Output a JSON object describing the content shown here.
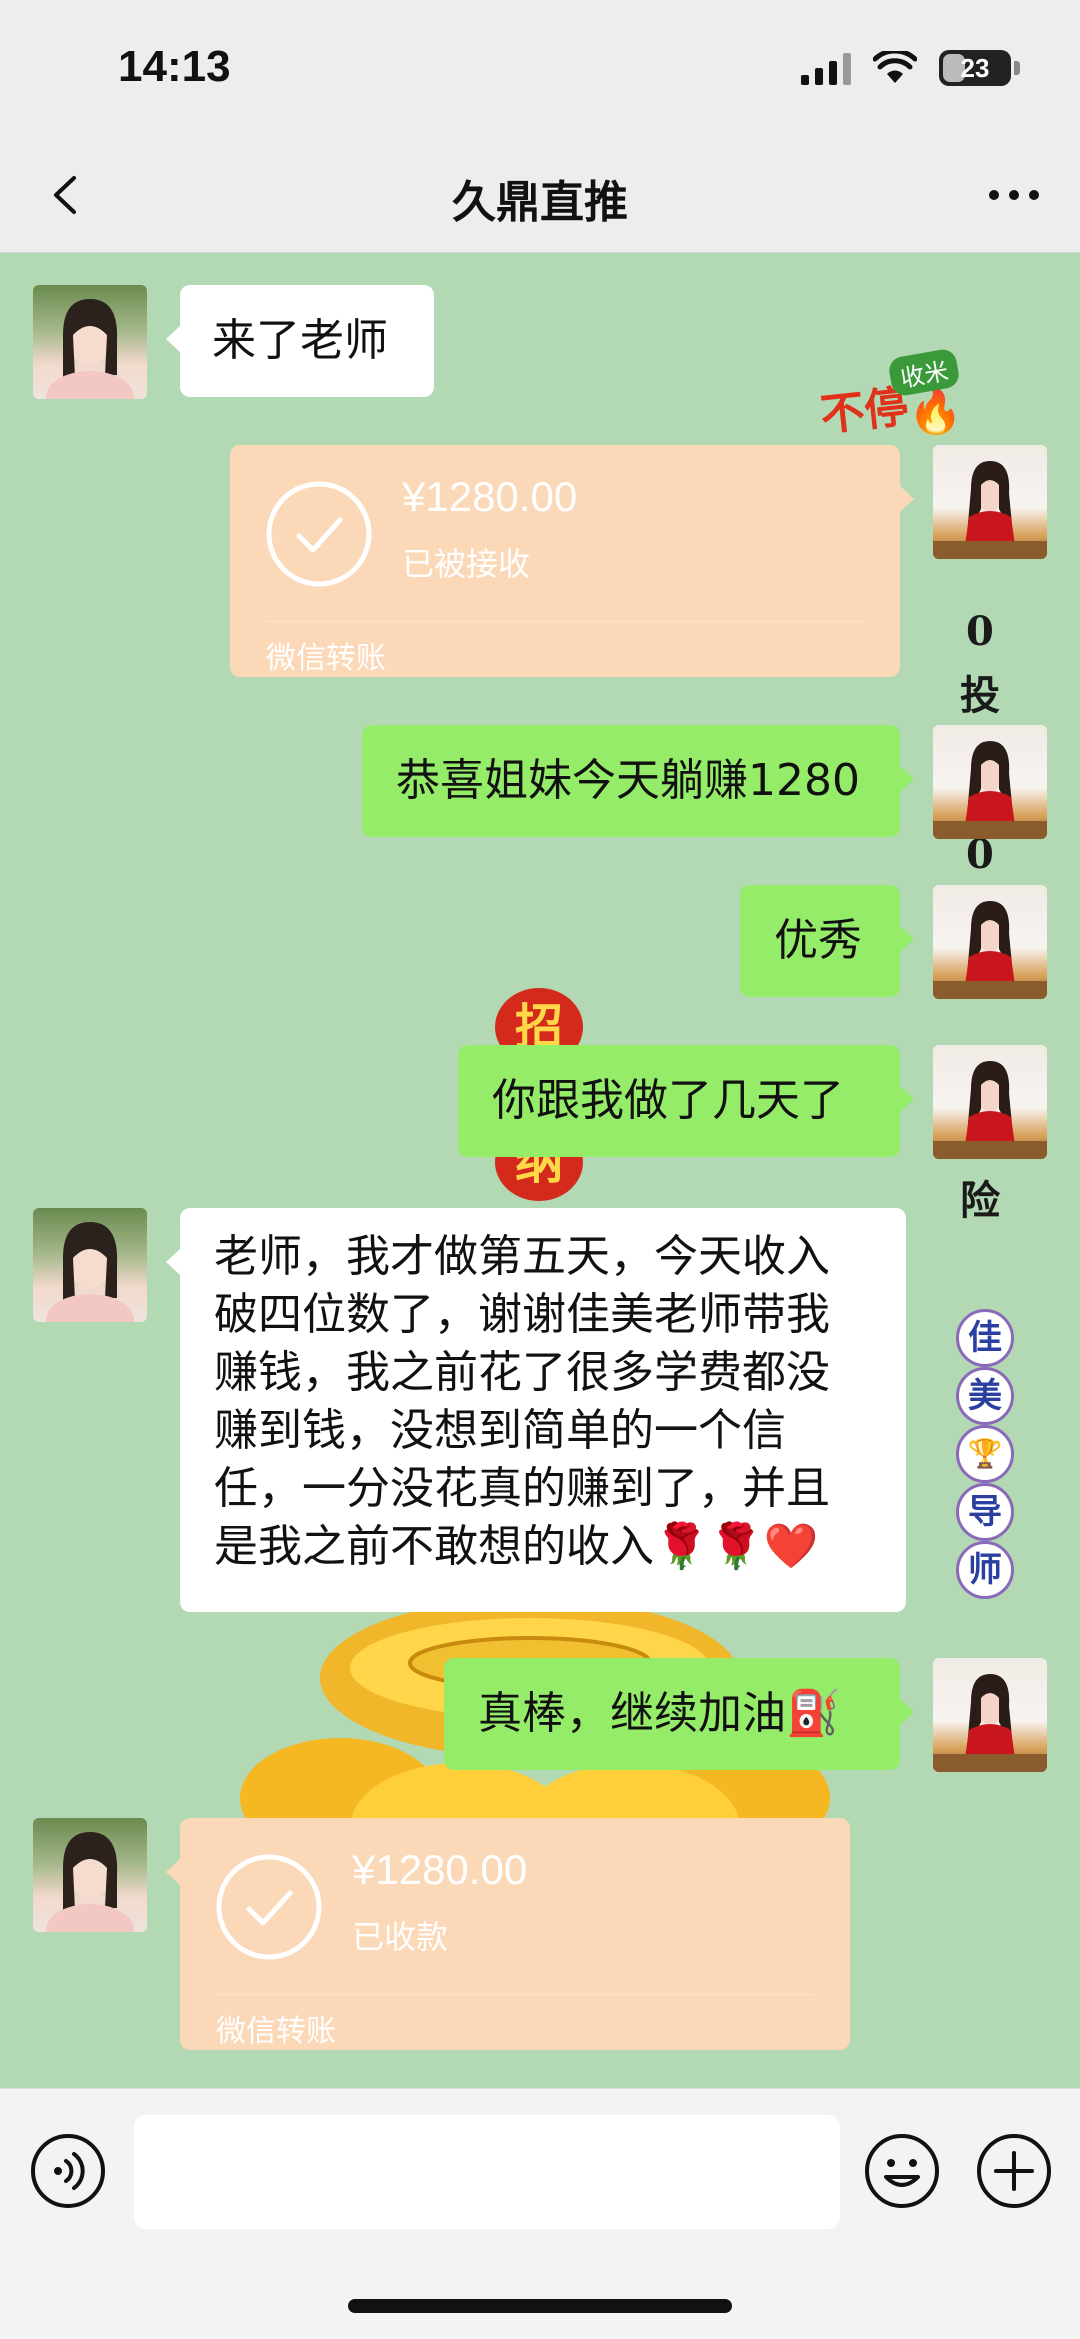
{
  "status_bar": {
    "time": "14:13",
    "battery": "23"
  },
  "nav": {
    "title": "久鼎直推"
  },
  "messages": [
    {
      "side": "left",
      "type": "text",
      "text": "来了老师"
    },
    {
      "side": "right",
      "type": "transfer",
      "amount": "¥1280.00",
      "status": "已被接收",
      "source": "微信转账"
    },
    {
      "side": "right",
      "type": "text",
      "text": "恭喜姐妹今天躺赚1280"
    },
    {
      "side": "right",
      "type": "text",
      "text": "优秀"
    },
    {
      "side": "right",
      "type": "text",
      "text": "你跟我做了几天了"
    },
    {
      "side": "left",
      "type": "text",
      "text": "老师，我才做第五天，今天收入破四位数了，谢谢佳美老师带我赚钱，我之前花了很多学费都没赚到钱，没想到简单的一个信任，一分没花真的赚到了，并且是我之前不敢想的收入🌹🌹❤️"
    },
    {
      "side": "right",
      "type": "text",
      "text": "真棒，继续加油⛽"
    },
    {
      "side": "left",
      "type": "transfer",
      "amount": "¥1280.00",
      "status": "已收款",
      "source": "微信转账"
    }
  ],
  "background_decor": {
    "sticker_top": "收米",
    "sticker_main": "不停",
    "vertical_chars": [
      "0",
      "投",
      "0",
      "险"
    ],
    "red_chars": [
      "招",
      "纳"
    ],
    "circle_chars": [
      "佳",
      "美",
      "🏆",
      "导",
      "师"
    ]
  },
  "input": {
    "placeholder": ""
  },
  "colors": {
    "chat_bg": "#b2d9b4",
    "green_bubble": "#95ec69",
    "transfer_bg": "#fbd9b8",
    "bar_bg": "#ededed"
  }
}
